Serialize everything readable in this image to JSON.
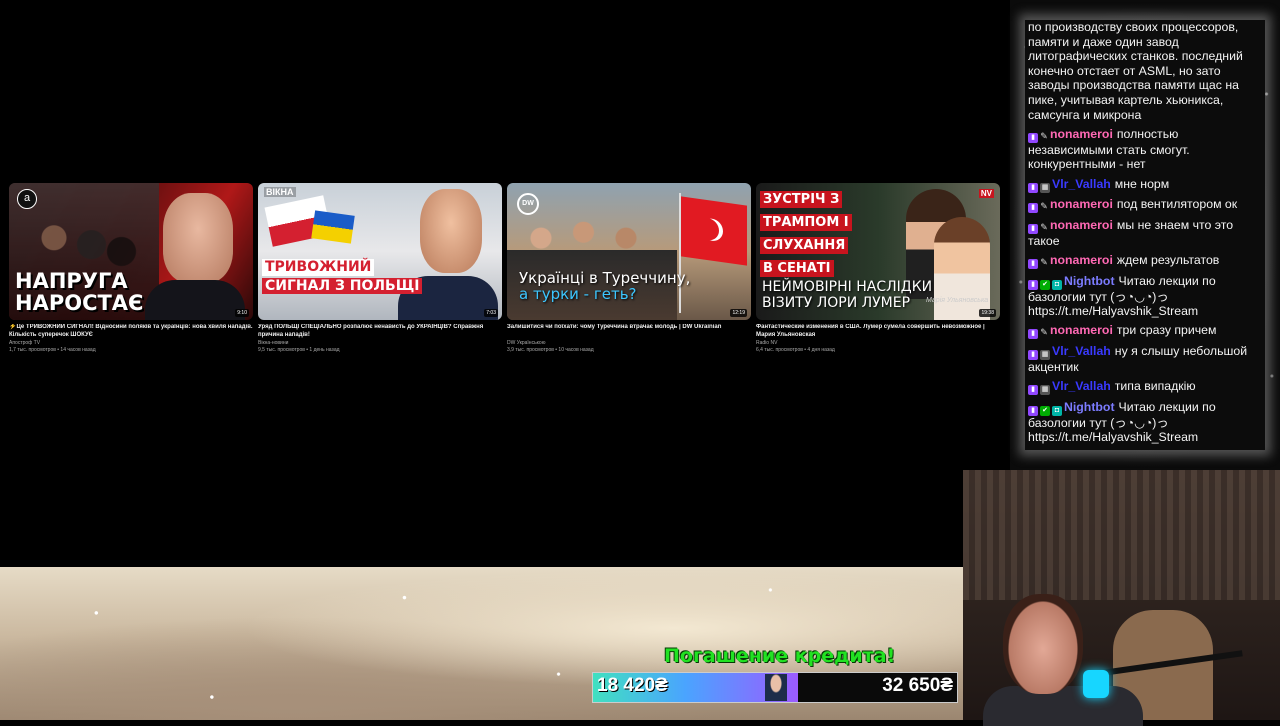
{
  "videos": [
    {
      "thumb_text": [
        "НАПРУГА",
        "НАРОСТАЄ"
      ],
      "logo": "a",
      "duration": "9:10",
      "title": "⚡Це ТРИВОЖНИЙ СИГНАЛ! Відносини поляків та українців: нова хвиля нападів. Кількість суперечок ШОКУЄ",
      "channel": "Апостроф TV",
      "meta": "1,7 тыс. просмотров • 14 часов назад"
    },
    {
      "tag": "ВІКНА",
      "thumb_text": [
        "ТРИВОЖНИЙ",
        "СИГНАЛ З ПОЛЬЩІ"
      ],
      "duration": "7:03",
      "title": "Уряд ПОЛЬЩІ СПЕЦІАЛЬНО розпалює ненависть до УКРАЇНЦІВ? Справжня причина нападів!",
      "channel": "Вікна-новини",
      "meta": "9,5 тыс. просмотров • 1 день назад"
    },
    {
      "logo": "DW",
      "thumb_text": [
        "Українці в Туреччину,",
        "а турки - геть?"
      ],
      "duration": "12:19",
      "title": "Залишитися чи поїхати: чому Туреччина втрачає молодь | DW Ukrainian",
      "channel": "DW Українською",
      "meta": "3,9 тыс. просмотров • 10 часов назад"
    },
    {
      "tag": "NV",
      "thumb_boxes": [
        "ЗУСТРІЧ З",
        "ТРАМПОМ І",
        "СЛУХАННЯ",
        "В СЕНАТІ"
      ],
      "thumb_text": [
        "НЕЙМОВІРНІ НАСЛІДКИ",
        "ВІЗИТУ ЛОРИ ЛУМЕР"
      ],
      "caption": "Марія Ульяновська",
      "duration": "19:38",
      "title": "Фантастические изменения в США. Лумер сумела совершить невозможное | Мария Ульяновская",
      "channel": "Radio NV",
      "meta": "6,4 тыс. просмотров • 4 дня назад"
    }
  ],
  "chat": {
    "messages": [
      {
        "badges": [],
        "user": "",
        "user_color": "",
        "text": "по производству своих процессоров, памяти и даже один завод литографических станков. последний конечно отстает от ASML, но зато заводы производства памяти щас на пике, учитывая картель хьюникса, самсунга и микрона"
      },
      {
        "badges": [
          "purple",
          "wrench"
        ],
        "user": "nonameroi",
        "user_color": "#ff69b4",
        "text": "полностью независимыми стать смогут. конкурентными - нет"
      },
      {
        "badges": [
          "purple",
          "gray"
        ],
        "user": "Vlr_Vallah",
        "user_color": "#3a3aff",
        "text": "мне норм"
      },
      {
        "badges": [
          "purple",
          "wrench"
        ],
        "user": "nonameroi",
        "user_color": "#ff69b4",
        "text": "под вентилятором ок"
      },
      {
        "badges": [
          "purple",
          "wrench"
        ],
        "user": "nonameroi",
        "user_color": "#ff69b4",
        "text": "мы не знаем что это такое"
      },
      {
        "badges": [
          "purple",
          "wrench"
        ],
        "user": "nonameroi",
        "user_color": "#ff69b4",
        "text": "ждем результатов"
      },
      {
        "badges": [
          "purple",
          "green",
          "teal"
        ],
        "user": "Nightbot",
        "user_color": "#7c7cff",
        "text": "Читаю лекции по базологии тут (っ◔◡◔)っ https://t.me/Halyavshik_Stream"
      },
      {
        "badges": [
          "purple",
          "wrench"
        ],
        "user": "nonameroi",
        "user_color": "#ff69b4",
        "text": "три сразу причем"
      },
      {
        "badges": [
          "purple",
          "gray"
        ],
        "user": "Vlr_Vallah",
        "user_color": "#3a3aff",
        "text": "ну я слышу небольшой акцентик"
      },
      {
        "badges": [
          "purple",
          "gray"
        ],
        "user": "Vlr_Vallah",
        "user_color": "#3a3aff",
        "text": "типа випадкію"
      },
      {
        "badges": [
          "purple",
          "green",
          "teal"
        ],
        "user": "Nightbot",
        "user_color": "#7c7cff",
        "text": "Читаю лекции по базологии тут (っ◔◡◔)っ https://t.me/Halyavshik_Stream"
      }
    ]
  },
  "goal": {
    "title": "Погашение кредита!",
    "current": "18 420₴",
    "target": "32 650₴",
    "progress_fraction": 0.564
  }
}
